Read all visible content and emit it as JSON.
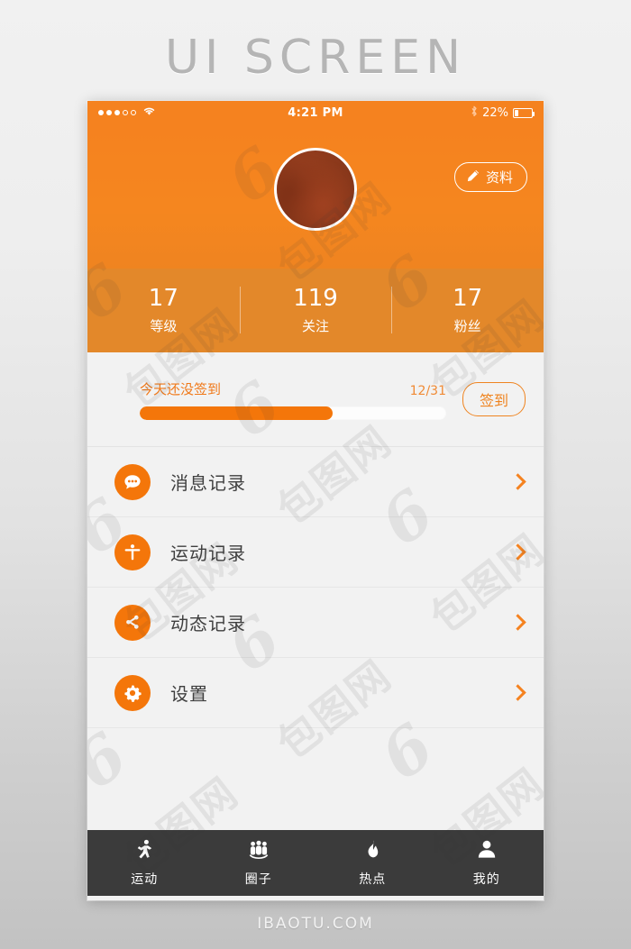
{
  "poster": {
    "title": "UI SCREEN",
    "footer": "IBAOTU.COM",
    "watermark": "包图网"
  },
  "statusbar": {
    "time": "4:21 PM",
    "battery_percent": "22%",
    "signal_icon": "signal-dots-icon",
    "wifi_icon": "wifi-icon",
    "bluetooth_icon": "bluetooth-icon",
    "battery_icon": "battery-icon"
  },
  "header": {
    "avatar_name": "user-avatar",
    "edit_button_label": "资料",
    "edit_icon": "pencil-icon"
  },
  "stats": [
    {
      "value": "17",
      "label": "等级"
    },
    {
      "value": "119",
      "label": "关注"
    },
    {
      "value": "17",
      "label": "粉丝"
    }
  ],
  "checkin": {
    "status_text": "今天还没签到",
    "date_text": "12/31",
    "progress_percent": 63,
    "button_label": "签到"
  },
  "menu": [
    {
      "label": "消息记录",
      "icon": "chat-bubble-icon",
      "chevron": "chevron-right-icon"
    },
    {
      "label": "运动记录",
      "icon": "person-run-icon",
      "chevron": "chevron-right-icon"
    },
    {
      "label": "动态记录",
      "icon": "share-nodes-icon",
      "chevron": "chevron-right-icon"
    },
    {
      "label": "设置",
      "icon": "gear-icon",
      "chevron": "chevron-right-icon"
    }
  ],
  "tabbar": [
    {
      "label": "运动",
      "icon": "running-icon"
    },
    {
      "label": "圈子",
      "icon": "group-people-icon"
    },
    {
      "label": "热点",
      "icon": "flame-icon"
    },
    {
      "label": "我的",
      "icon": "person-icon"
    }
  ],
  "colors": {
    "brand_orange": "#f5821f",
    "stats_orange": "#e3882a",
    "icon_orange": "#f4760a",
    "tabbar_dark": "#3b3b3b",
    "panel_gray": "#f2f2f2"
  }
}
